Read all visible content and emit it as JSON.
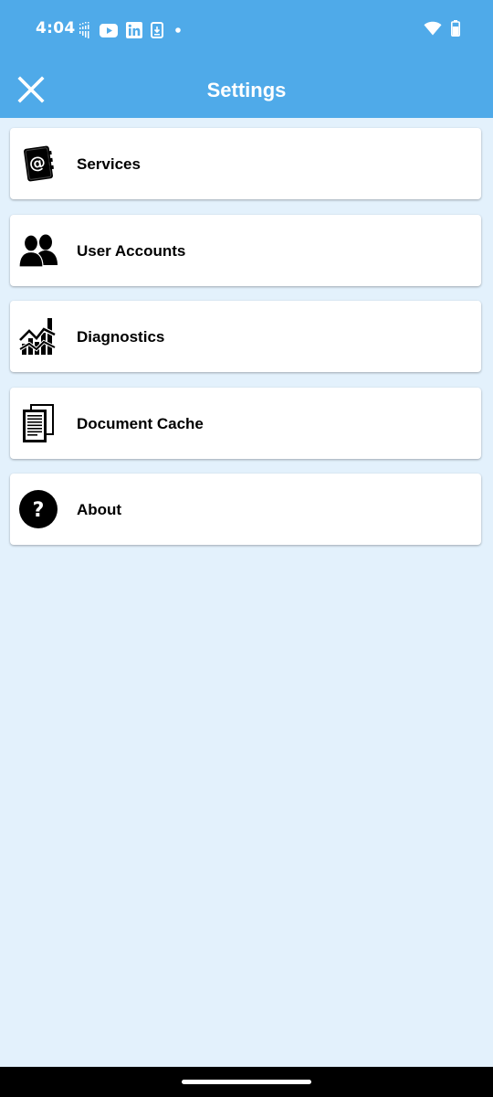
{
  "status_bar": {
    "time": "4:04",
    "left_icons": [
      "sim-signal-icon",
      "youtube-icon",
      "linkedin-icon",
      "download-icon",
      "notification-dot-icon"
    ],
    "right_icons": [
      "wifi-icon",
      "battery-icon"
    ],
    "background_color": "#4faae9"
  },
  "header": {
    "title": "Settings",
    "close_icon": "close-icon",
    "background_color": "#4faae9"
  },
  "settings_items": [
    {
      "label": "Services",
      "icon": "address-book-icon"
    },
    {
      "label": "User Accounts",
      "icon": "users-icon"
    },
    {
      "label": "Diagnostics",
      "icon": "chart-icon"
    },
    {
      "label": "Document Cache",
      "icon": "documents-icon"
    },
    {
      "label": "About",
      "icon": "help-icon"
    }
  ],
  "colors": {
    "page_background": "#e3f1fc",
    "card_background": "#ffffff",
    "navigation_bar": "#000000"
  }
}
